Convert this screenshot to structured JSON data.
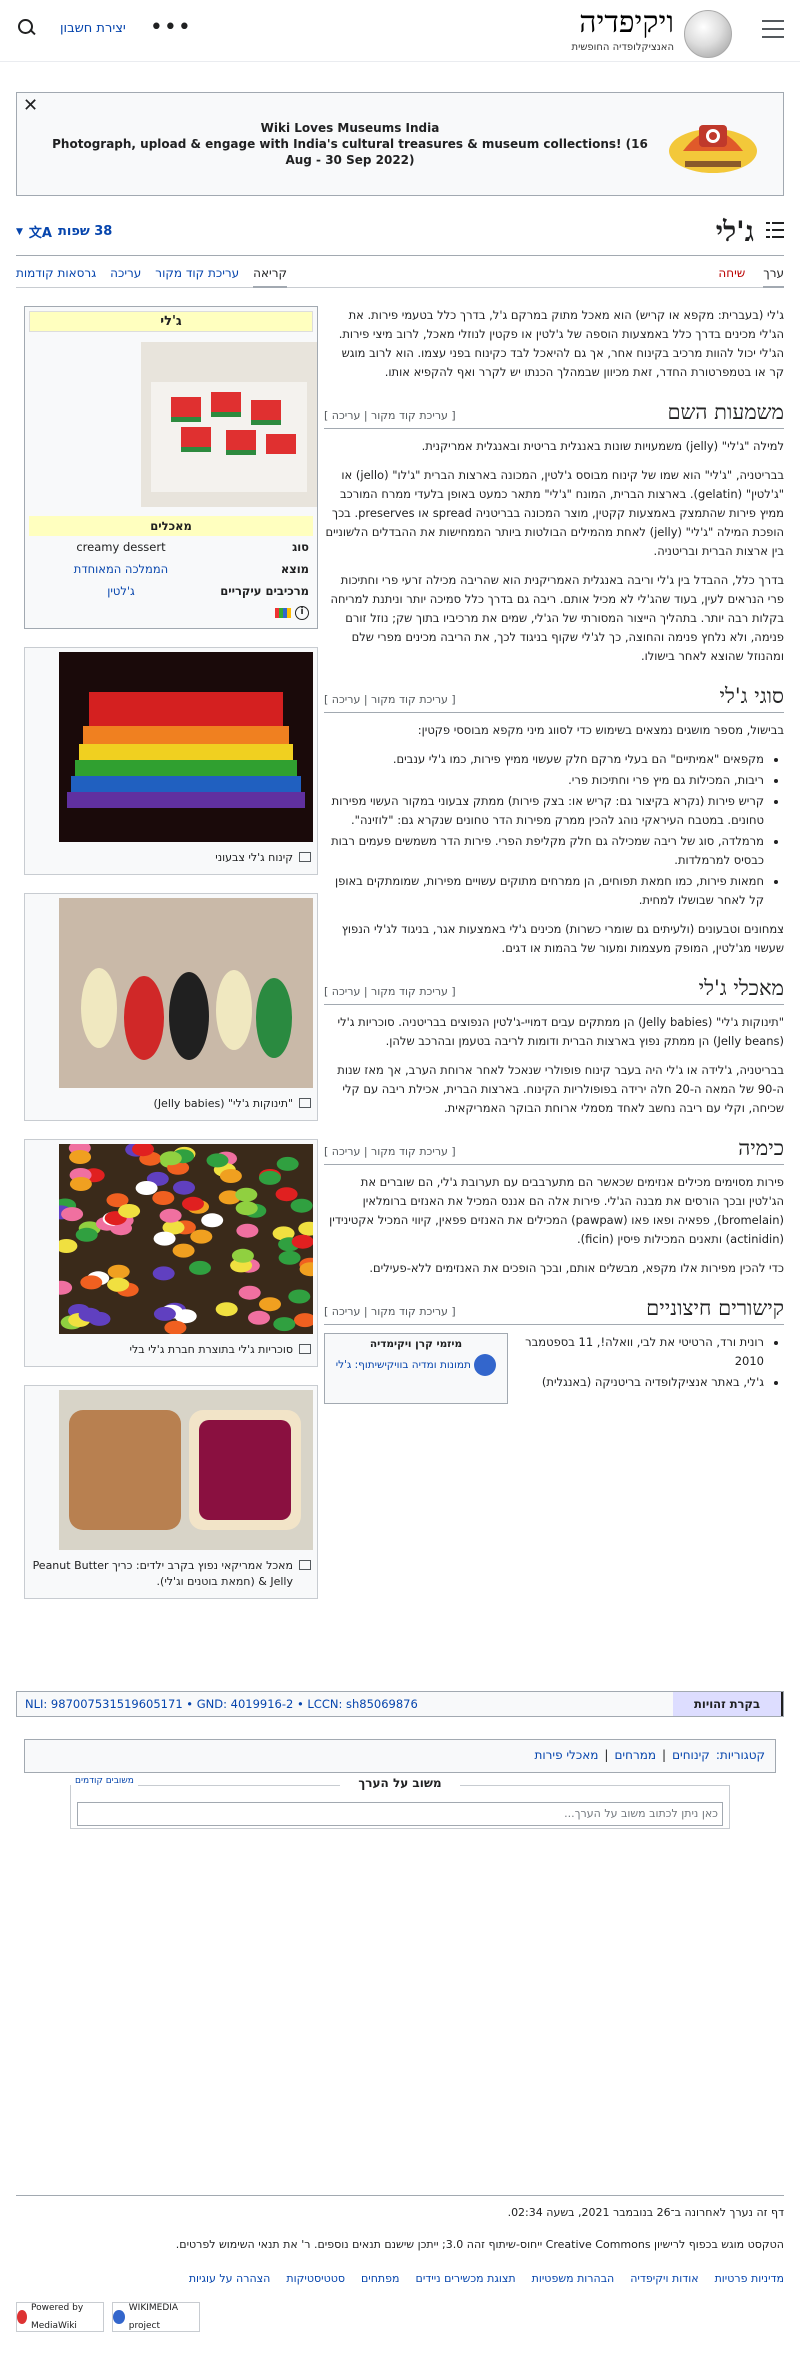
{
  "header": {
    "wordmark": "ויקיפדיה",
    "tagline": "האנציקלופדיה החופשית",
    "create_account": "יצירת חשבון",
    "more_icon": "more-icon",
    "search_icon": "search-icon"
  },
  "banner": {
    "title": "Wiki Loves Museums India",
    "text": "Photograph, upload & engage with India's cultural treasures & museum collections! (16 Aug - 30 Sep 2022)"
  },
  "page": {
    "title": "ג'לי",
    "languages": "38 שפות"
  },
  "tabs": {
    "article": "ערך",
    "talk": "שיחה",
    "read": "קריאה",
    "edit_source": "עריכת קוד מקור",
    "edit": "עריכה",
    "history": "גרסאות קודמות"
  },
  "infobox": {
    "title": "ג'לי",
    "subtitle": "מאכלים",
    "rows": [
      {
        "k": "סוג",
        "v": "creamy dessert"
      },
      {
        "k": "מוצא",
        "v": "הממלכה המאוחדת"
      },
      {
        "k": "מרכיבים עיקריים",
        "v": "ג'לטין"
      }
    ]
  },
  "thumbs": [
    {
      "cap": "קינוח ג'לי צבעוני"
    },
    {
      "cap": "\"תינוקות ג'לי\" (Jelly babies)"
    },
    {
      "cap": "סוכריות ג'לי בתוצרת חברת ג'לי בלי"
    },
    {
      "cap": "מאכל אמריקאי נפוץ בקרב ילדים: כריך Peanut Butter & Jelly (חמאת בוטנים וג'לי)."
    }
  ],
  "sections": {
    "intro": "ג'לי (בעברית: מקפא או קריש) הוא מאכל מתוק במרקם ג'ל, בדרך כלל בטעמי פירות. את הג'לי מכינים בדרך כלל באמצעות הוספה של ג'לטין או פקטין לנוזלי מאכל, לרוב מיצי פירות. הג'לי יכול להוות מרכיב בקינוח אחר, אך גם להיאכל לבד כקינוח בפני עצמו. הוא לרוב מוגש קר או בטמפרטורת החדר, זאת מכיוון שבמהלך הכנתו יש לקרר ואף להקפיא אותו.",
    "etym_title": "משמעות השם",
    "edit_links": "[ עריכת קוד מקור | עריכה ]",
    "etym_p1": "למילה \"ג'לי\" (jelly) משמעויות שונות באנגלית בריטית ובאנגלית אמריקנית.",
    "etym_p2": "בבריטניה, \"ג'לי\" הוא שמו של קינוח מבוסס ג'לטין, המכונה בארצות הברית \"ג'לו\" (jello) או \"ג'לטין\" (gelatin). בארצות הברית, המונח \"ג'לי\" מתאר כמעט באופן בלעדי ממרח המורכב ממיץ פירות שהתמצק באמצעות קקטין, מוצר המכונה בבריטניה spread או preserves. בכך הופכת המילה \"ג'לי\" (jelly) לאחת מהמילים הבולטות ביותר הממחישות את ההבדלים הלשוניים בין ארצות הברית ובריטניה.",
    "etym_p3": "בדרך כלל, ההבדל בין ג'לי וריבה באנגלית האמריקנית הוא שהריבה מכילה זרעי פרי וחתיכות פרי הנראים לעין, בעוד שהג'לי לא מכיל אותם. ריבה גם בדרך כלל סמיכה יותר וניתנת למריחה בקלות רבה יותר. בתהליך הייצור המסורתי של הג'לי, שמים את מרכיביו בתוך שק; נוזל זורם פנימה, ולא נלחץ פנימה והחוצה, כך לג'לי שקוף בניגוד לכך, את הריבה מכינים מפרי שלם ומהנוזל שהוצא לאחר בישולו.",
    "types_title": "סוגי ג'לי",
    "types_p1": "בבישול, מספר מושגים נמצאים בשימוש כדי לסווג מיני מקפא מבוססי פקטין:",
    "types_list": [
      "מקפאים \"אמיתיים\" הם בעלי מרקם חלק שעשוי ממיץ פירות, כמו ג'לי ענבים.",
      "ריבות, המכילות גם מיץ פרי וחתיכות פרי.",
      "קריש פירות (נקרא בקיצור גם: קריש או: בצק פירות) ממתק צבעוני במקור העשוי מפירות טחונים. במטבח העיראקי נוהג להכין ממרק מפירות הדר טחונים שנקרא גם: \"לוזינה\".",
      "מרמלדה, סוג של ריבה שמכילה גם חלק מקליפת הפרי. פירות הדר משמשים פעמים רבות כבסיס למרמלדות.",
      "חמאות פירות, כמו חמאת תפוחים, הן ממרחים מתוקים עשויים מפירות, שמומתקים באופן קל לאחר שבושלו למחית."
    ],
    "types_p2": "צמחונים וטבעונים (ולעיתים גם שומרי כשרות) מכינים ג'לי באמצעות אגר, בניגוד לג'לי הנפוץ שעשוי מג'לטין, המופק מעצמות ומעור של בהמות או דגים.",
    "foods_title": "מאכלי ג'לי",
    "foods_p1": "\"תינוקות ג'לי\" (Jelly babies) הן ממתקים עבים דמויי-ג'לטין הנפוצים בבריטניה. סוכריות ג'לי (Jelly beans) הן ממתק נפוץ בארצות הברית ודומות לריבה בטעמן ובהרכב שלהן.",
    "foods_p2": "בבריטניה, ג'לידה או ג'לי היה בעבר קינוח פופולרי שנאכל לאחר ארוחת הערב, אך מאז שנות ה-90 של המאה ה-20 חלה ירידה בפופולריות הקינוח. בארצות הברית, אכילת ריבה עם קלי שכיחה, וקלי עם ריבה נחשב לאחד מסמלי ארוחת הבוקר האמריקאית.",
    "chem_title": "כימיה",
    "chem_p1": "פירות מסוימים מכילים אנזימים שכאשר הם מתערבבים עם תערובת ג'לי, הם שוברים את הג'לטין ובכך הורסים את מבנה הג'לי. פירות אלה הם אננס המכיל את האנזים ברומלאין (bromelain), פפאיה ופאו פאו (pawpaw) המכילים את האנזים פפאין, קיווי המכיל אקטינידין (actinidin) ותאנים המכילות פיסין (ficin).",
    "chem_p2": "כדי להכין מפירות אלו מקפא, מבשלים אותם, ובכך הופכים את האנזימים ללא-פעילים.",
    "ext_title": "קישורים חיצוניים",
    "ext_list": [
      "רונית ורד, הרטיטי את לבי, וואלה!, 11 בספטמבר 2010",
      "ג'לי, באתר אנציקלופדיה בריטניקה (באנגלית)"
    ],
    "sister_title": "מיזמי קרן ויקימדיה",
    "sister_text": "תמונות ומדיה בוויקישיתוף: ג'לי"
  },
  "authority": {
    "label": "בקרת זהויות",
    "values": "NLI: 987007531519605171 • GND: 4019916-2 • LCCN: sh85069876"
  },
  "categories": {
    "label": "קטגוריות:",
    "items": [
      "קינוחים",
      "ממרחים",
      "מאכלי פירות"
    ]
  },
  "feedback": {
    "title": "משוב על הערך",
    "prev": "משובים קודמים",
    "placeholder": "כאן ניתן לכתוב משוב על הערך..."
  },
  "footer": {
    "modified": "דף זה נערך לאחרונה ב־26 בנובמבר 2021, בשעה 02:34.",
    "license": "הטקסט מוגש בכפוף לרישיון Creative Commons ייחוס-שיתוף זהה 3.0; ייתכן שישנם תנאים נוספים. ר' את תנאי השימוש לפרטים.",
    "links": [
      "מדיניות פרטיות",
      "אודות ויקיפדיה",
      "הבהרות משפטיות",
      "תצוגת מכשירים ניידים",
      "מפתחים",
      "סטטיסטיקות",
      "הצהרה על עוגיות"
    ],
    "badge1": "Powered by MediaWiki",
    "badge2": "WIKIMEDIA project"
  },
  "colors": {
    "link": "#0645ad",
    "redlink": "#ba0000",
    "infobox_header": "#ffffbf"
  }
}
